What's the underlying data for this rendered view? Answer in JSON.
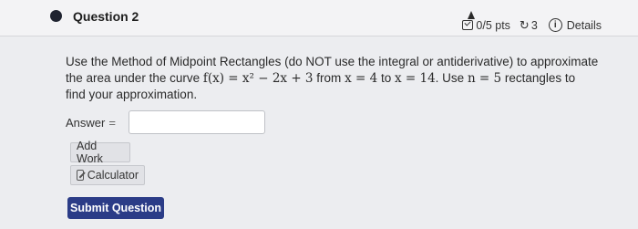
{
  "header": {
    "title": "Question 2",
    "points": "0/5 pts",
    "retries": "3",
    "details_label": "Details"
  },
  "question": {
    "line1": "Use the Method of Midpoint Rectangles (do NOT use the integral or antiderivative) to approximate",
    "line2_start": "the area under the curve",
    "function": "f(x) = x² − 2x + 3",
    "from_text": "from",
    "from_expr": "x = 4",
    "to_text": "to",
    "to_expr": "x = 14",
    "use_text": ". Use",
    "n_expr": "n = 5",
    "line2_end": "rectangles to",
    "line3": "find your approximation."
  },
  "answer": {
    "label": "Answer",
    "equals": "=",
    "value": ""
  },
  "buttons": {
    "add_work": "Add Work",
    "calculator": "Calculator",
    "submit": "Submit Question"
  }
}
